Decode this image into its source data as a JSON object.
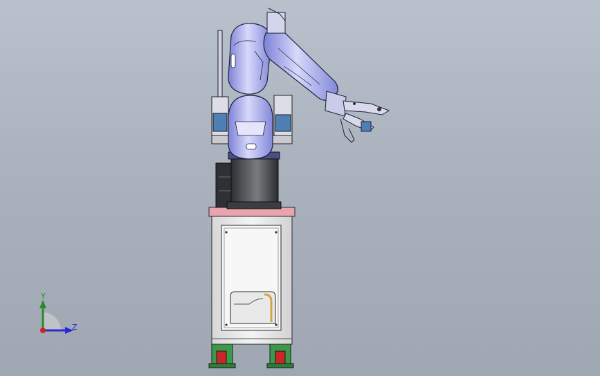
{
  "viewport": {
    "background_color": "#aab2bd"
  },
  "model": {
    "colors": {
      "arm_body": "#9a9ee2",
      "arm_highlight": "#d7d9fb",
      "arm_outline": "#1d1f3a",
      "base_cylinder": "#3c3e42",
      "cabinet": "#eeeeee",
      "cabinet_top": "#e29aa3",
      "foot_green": "#2f9d47",
      "foot_red": "#c9252b",
      "window_accent": "#d4a34b"
    }
  },
  "triad": {
    "y_label": "Y",
    "z_label": "Z",
    "y_color": "#2a8a2a",
    "z_color": "#2a2ad0",
    "origin_color": "#cc2222"
  }
}
